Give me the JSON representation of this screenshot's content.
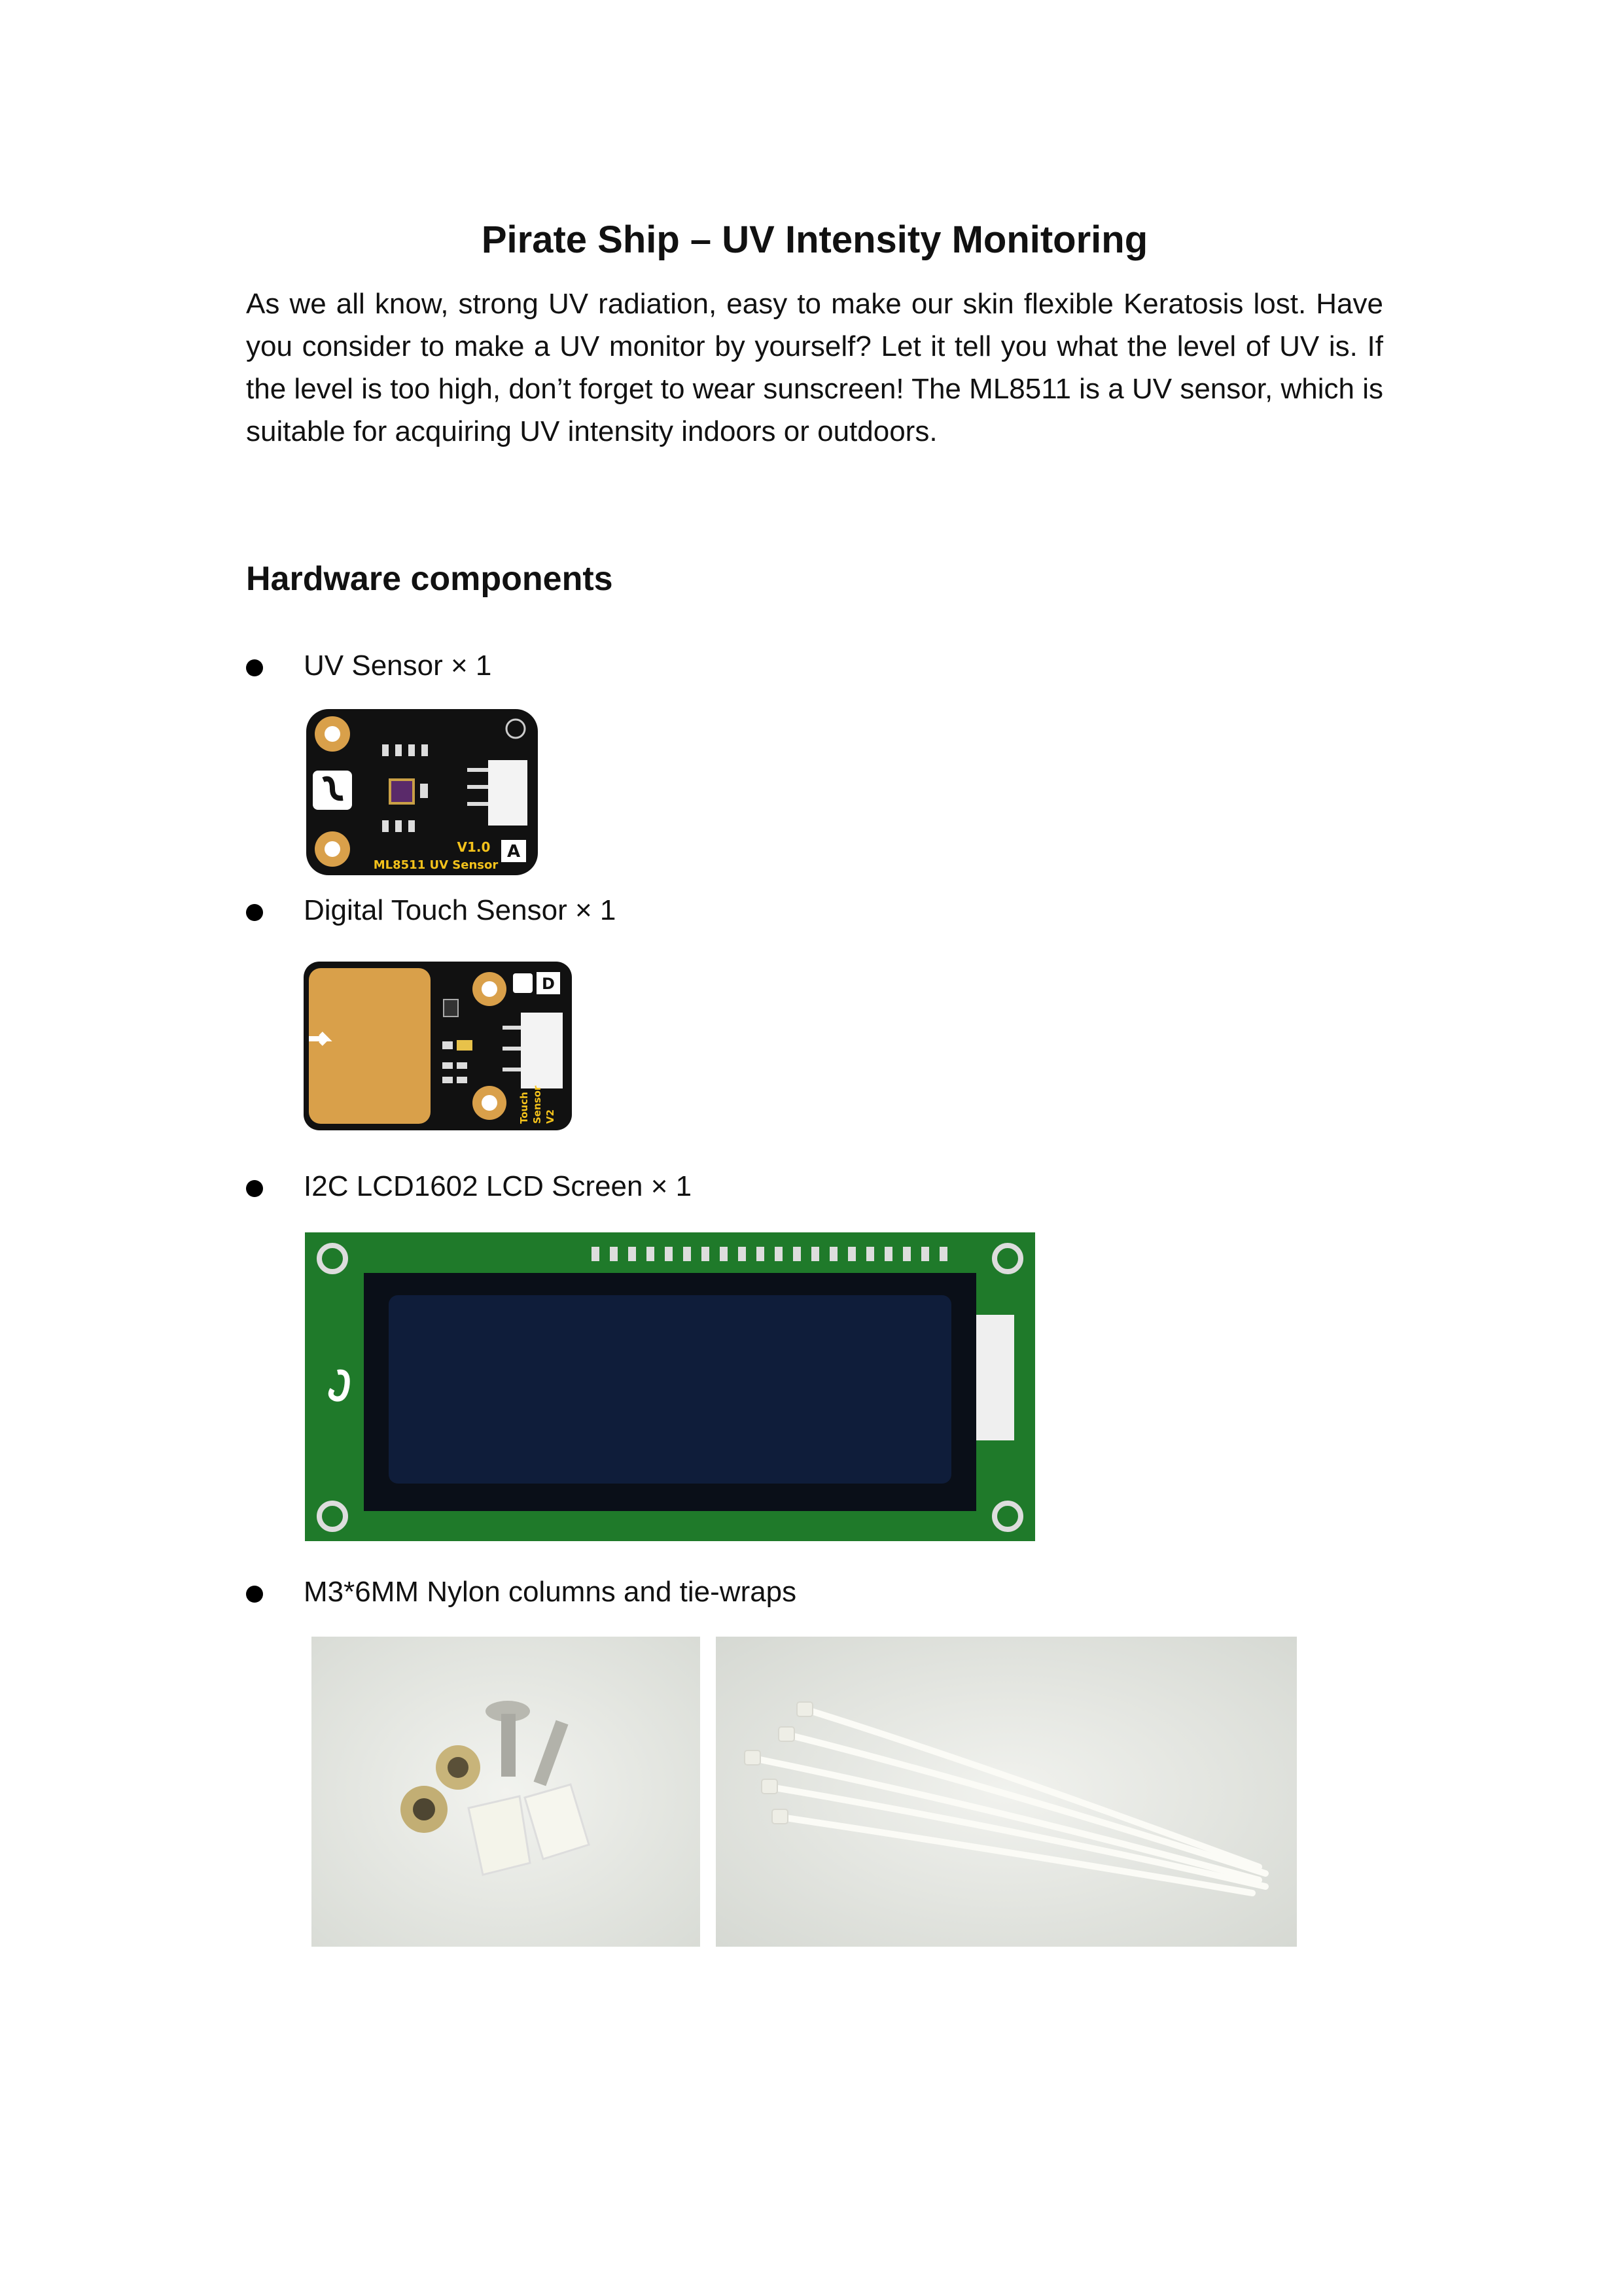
{
  "document": {
    "title": "Pirate Ship – UV Intensity Monitoring",
    "intro": "As we all know, strong UV radiation, easy to make our skin flexible Keratosis lost. Have you consider to make a UV monitor by yourself? Let it tell you what the level of UV is. If the level is too high, don’t forget to wear sunscreen! The ML8511 is a UV sensor, which is suitable for acquiring UV intensity indoors or outdoors.",
    "section_heading": "Hardware components"
  },
  "components": [
    {
      "label": "UV Sensor  ×  1"
    },
    {
      "label": "Digital Touch Sensor × 1"
    },
    {
      "label": "I2C LCD1602 LCD Screen × 1"
    },
    {
      "label": "M3*6MM Nylon columns and tie-wraps"
    }
  ],
  "board_labels": {
    "uv_version": "V1.0",
    "uv_name": "ML8511 UV Sensor",
    "uv_type": "A",
    "touch_type": "D",
    "touch_line1": "Touch",
    "touch_line2": "Sensor",
    "touch_line3": "V2"
  },
  "colors": {
    "board": "#111111",
    "gold_pad": "#d9a04a",
    "lcd_pcb": "#1f7a2a",
    "lcd_screen": "#0f1d3a"
  }
}
